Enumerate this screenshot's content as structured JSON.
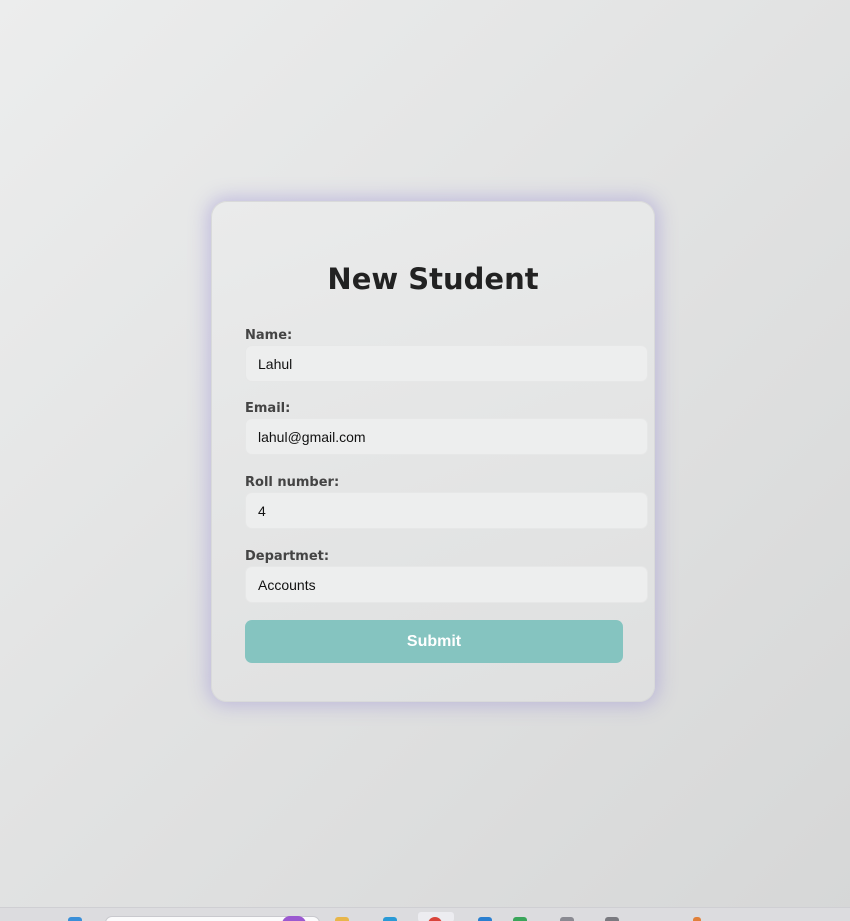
{
  "form": {
    "title": "New Student",
    "fields": [
      {
        "label": "Name:",
        "value": "Lahul"
      },
      {
        "label": "Email:",
        "value": "lahul@gmail.com"
      },
      {
        "label": "Roll number:",
        "value": "4"
      },
      {
        "label": "Departmet:",
        "value": "Accounts"
      }
    ],
    "submit_label": "Submit"
  },
  "colors": {
    "accent": "#85c4c0",
    "card_glow": "#968cd2"
  },
  "taskbar": {
    "icons": [
      "start-icon",
      "search-box",
      "copilot-icon",
      "file-explorer-icon",
      "edge-icon",
      "chrome-icon",
      "vscode-icon",
      "excel-icon",
      "app-icon",
      "settings-icon",
      "app-icon"
    ]
  }
}
